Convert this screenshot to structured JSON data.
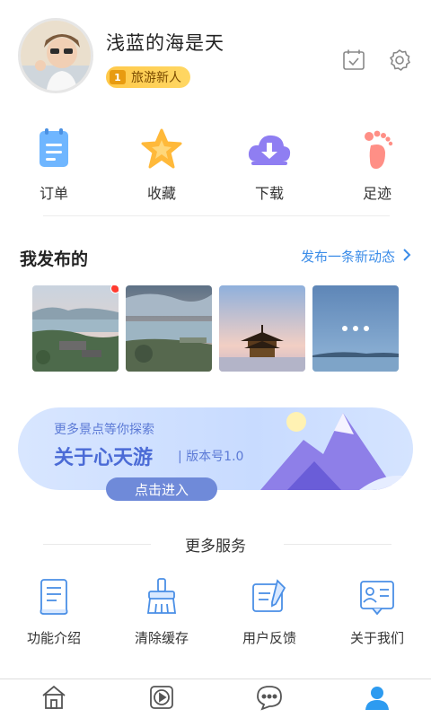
{
  "profile": {
    "username": "浅蓝的海是天",
    "badge_level": "1",
    "badge_label": "旅游新人"
  },
  "header_icons": [
    "calendar-check-icon",
    "settings-gear-icon"
  ],
  "quick_actions": [
    {
      "label": "订单",
      "icon": "order-list-icon"
    },
    {
      "label": "收藏",
      "icon": "star-favorite-icon"
    },
    {
      "label": "下载",
      "icon": "cloud-download-icon"
    },
    {
      "label": "足迹",
      "icon": "footprint-icon"
    }
  ],
  "my_posts": {
    "title": "我发布的",
    "link_label": "发布一条新动态",
    "more_label": "•••"
  },
  "banner": {
    "subtitle": "更多景点等你探索",
    "title": "关于心天游",
    "version": "| 版本号1.0",
    "button_label": "点击进入"
  },
  "services": {
    "title": "更多服务",
    "items": [
      {
        "label": "功能介绍",
        "icon": "feature-scroll-icon"
      },
      {
        "label": "清除缓存",
        "icon": "broom-clear-icon"
      },
      {
        "label": "用户反馈",
        "icon": "feedback-edit-icon"
      },
      {
        "label": "关于我们",
        "icon": "about-card-icon"
      }
    ]
  },
  "tabbar": [
    {
      "icon": "home-icon",
      "active": false
    },
    {
      "icon": "video-play-icon",
      "active": false
    },
    {
      "icon": "chat-bubble-icon",
      "active": false
    },
    {
      "icon": "user-profile-icon",
      "active": true
    }
  ],
  "colors": {
    "accent": "#3b8ce8",
    "badge": "#ffd04d",
    "banner_bg": "#cfe0ff",
    "tab_active": "#2d9bf0",
    "tab_inactive": "#555555"
  }
}
